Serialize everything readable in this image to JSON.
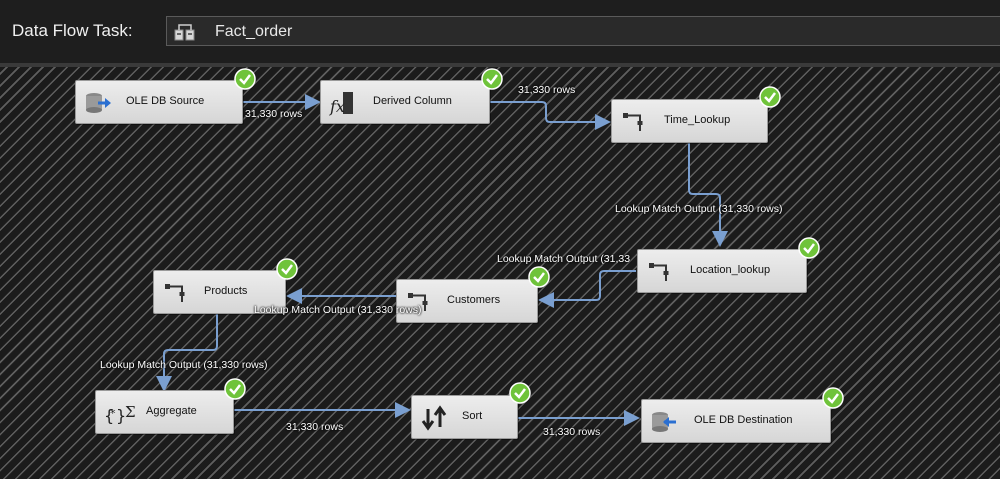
{
  "header": {
    "label": "Data Flow Task:",
    "selected_task": "Fact_order"
  },
  "nodes": {
    "ole_db_source": "OLE DB Source",
    "derived_column": "Derived Column",
    "time_lookup": "Time_Lookup",
    "location_lookup": "Location_lookup",
    "customers": "Customers",
    "products": "Products",
    "aggregate": "Aggregate",
    "sort": "Sort",
    "ole_db_destination": "OLE DB Destination"
  },
  "edges": {
    "source_to_derived": "31,330 rows",
    "derived_to_time": "31,330 rows",
    "time_to_location": "Lookup Match Output (31,330 rows)",
    "location_to_customers": "Lookup Match Output (31,33",
    "customers_to_products": "Lookup Match Output (31,330 rows)",
    "products_to_aggregate": "Lookup Match Output (31,330 rows)",
    "aggregate_to_sort": "31,330 rows",
    "sort_to_destination": "31,330 rows"
  },
  "colors": {
    "connector": "#7a9fd0",
    "success": "#6fc33a",
    "node_fill": "#e2e2e2"
  },
  "icons": {
    "task": "data-flow-task-icon",
    "status": "success-check-icon"
  }
}
